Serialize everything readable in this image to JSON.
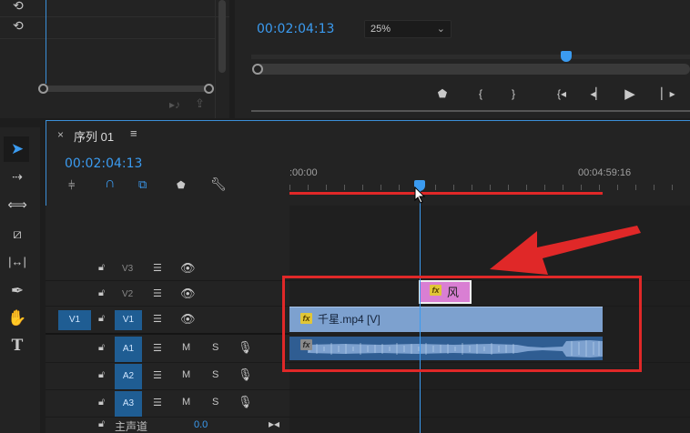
{
  "program": {
    "timecode": "00:02:04:13",
    "zoom": "25%"
  },
  "sequence": {
    "close_glyph": "×",
    "name": "序列 01",
    "menu_glyph": "≡",
    "timecode": "00:02:04:13",
    "ruler_start": ":00:00",
    "ruler_end": "00:04:59:16"
  },
  "tracks": {
    "video": [
      {
        "name": "V3"
      },
      {
        "name": "V2"
      },
      {
        "name": "V1",
        "source": "V1"
      }
    ],
    "audio": [
      {
        "name": "A1",
        "m": "M",
        "s": "S"
      },
      {
        "name": "A2",
        "m": "M",
        "s": "S"
      },
      {
        "name": "A3",
        "m": "M",
        "s": "S"
      }
    ],
    "master": {
      "label": "主声道",
      "value": "0.0"
    }
  },
  "clips": {
    "title": {
      "label": "风",
      "fx": "fx"
    },
    "video": {
      "label": "千星.mp4 [V]",
      "fx": "fx"
    },
    "audio": {
      "fx": "fx"
    }
  },
  "colors": {
    "accent": "#3b9bf0",
    "annotation": "#e02828",
    "title_clip": "#d97fd3",
    "video_clip": "#7da1cf",
    "audio_clip": "#2f5d92"
  }
}
